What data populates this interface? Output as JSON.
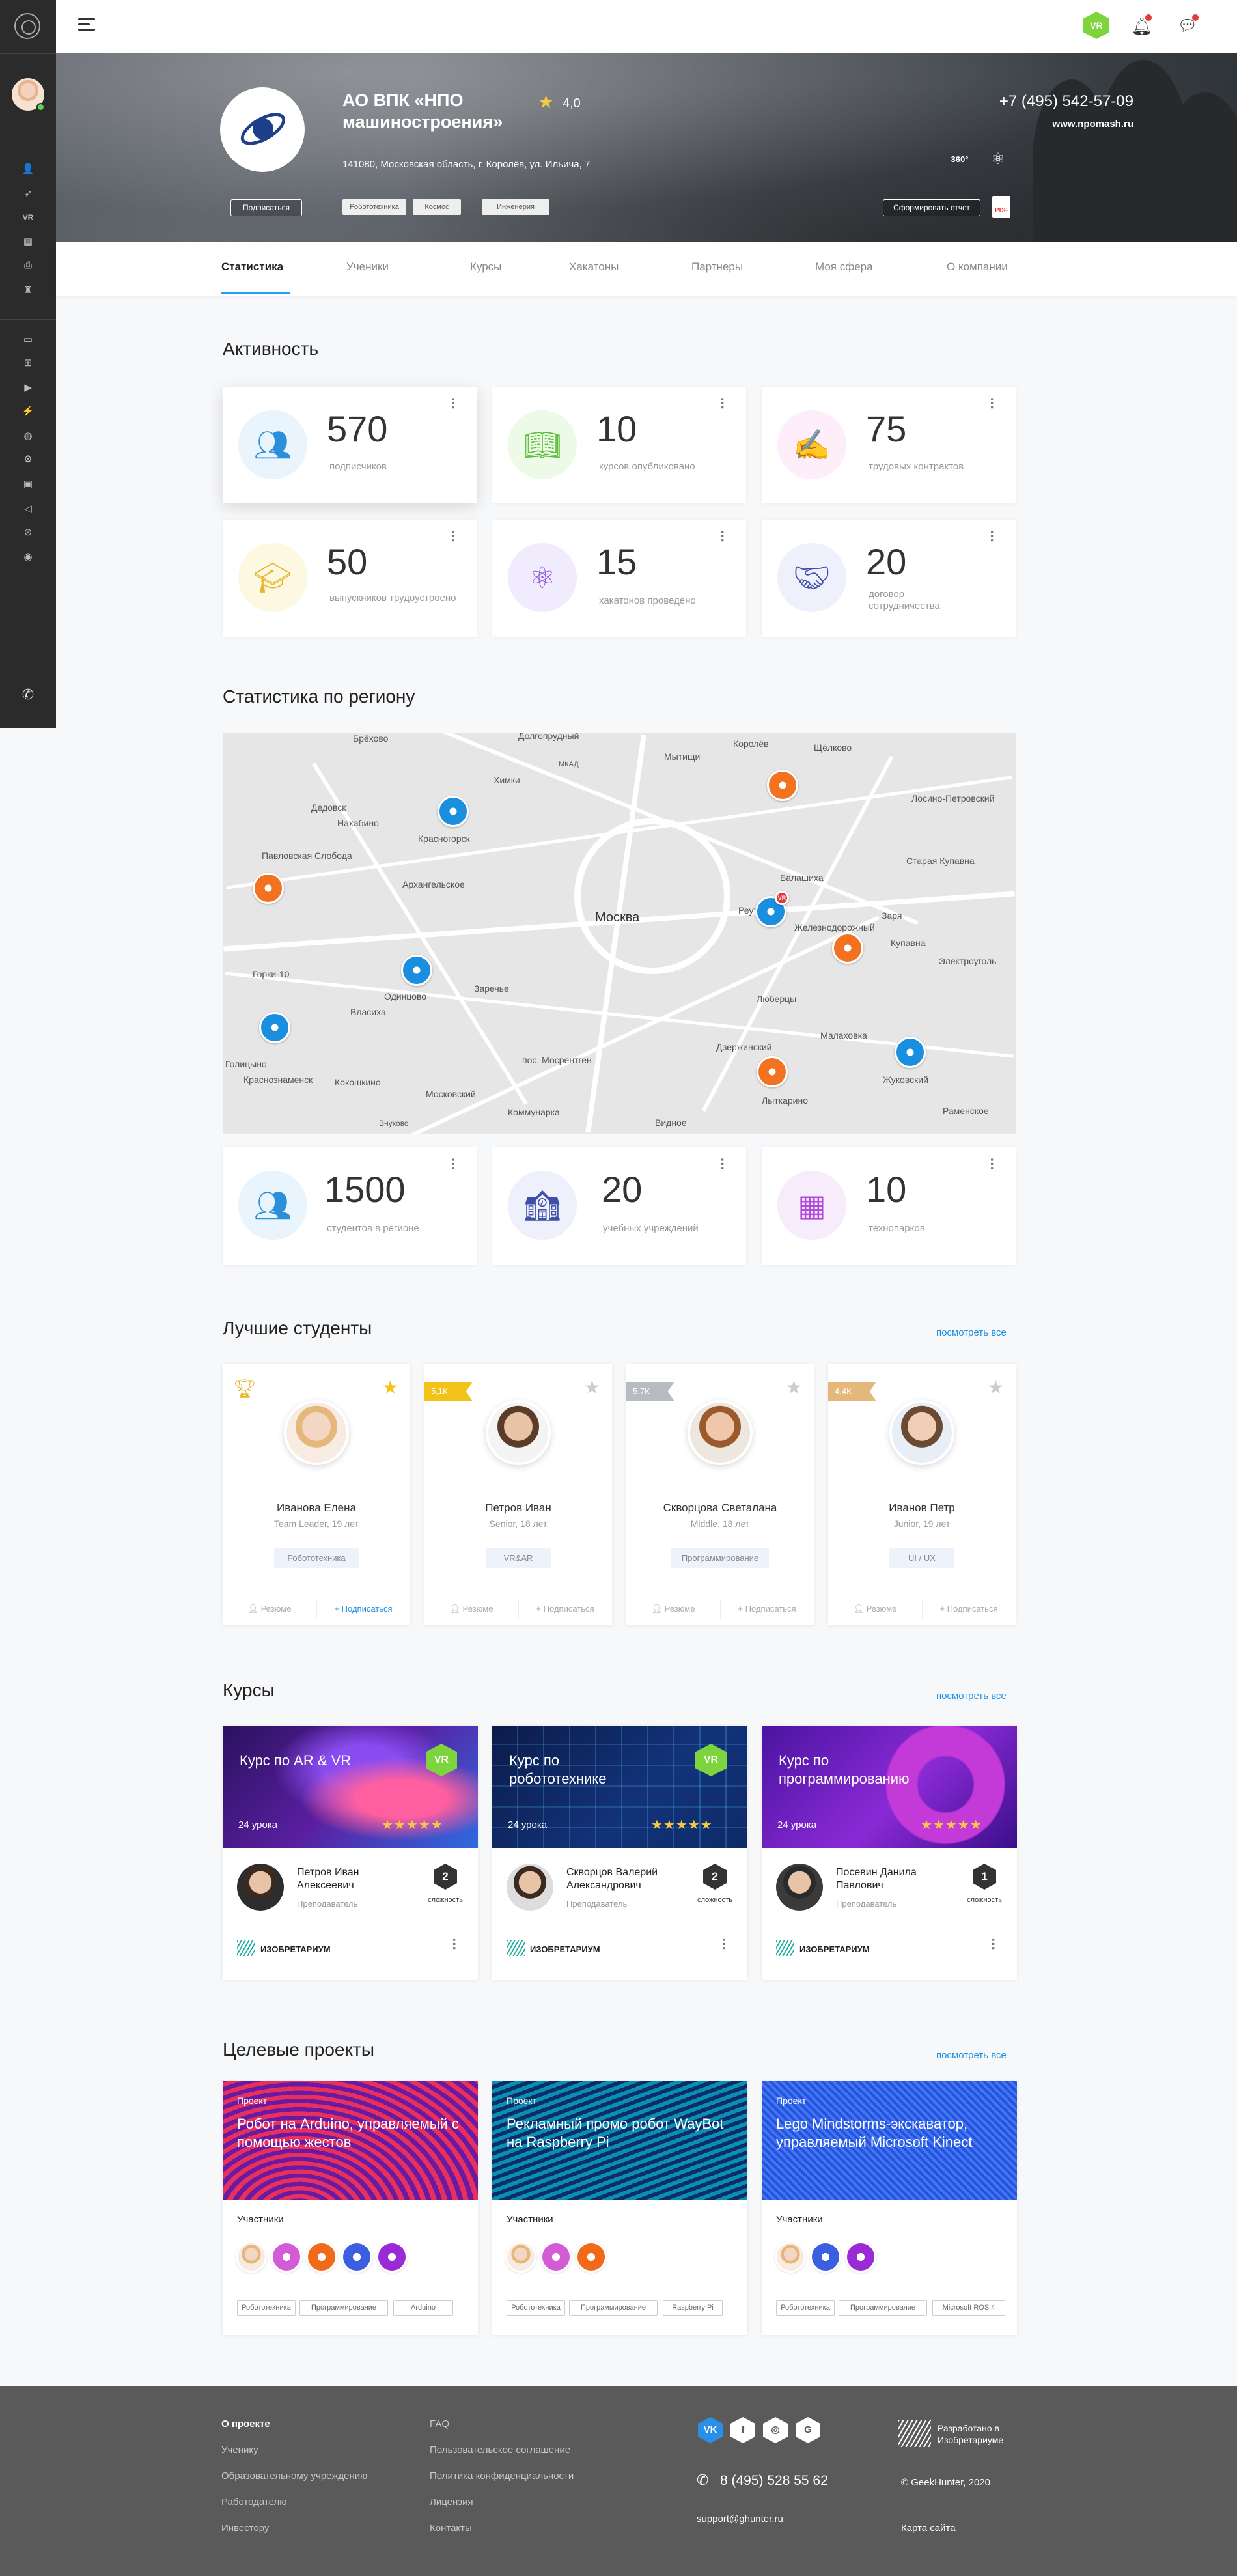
{
  "company": {
    "name": "АО ВПК «НПО машиностроения»",
    "rating": "4,0",
    "address": "141080, Московская область, г. Королёв, ул. Ильича, 7",
    "phone": "+7 (495) 542-57-09",
    "site": "www.npomash.ru",
    "subscribe_label": "Подписаться",
    "tags": [
      "Робототехника",
      "Космос",
      "Инженерия"
    ],
    "report_label": "Сформировать отчет",
    "icon_360": "360°",
    "pdf_label": "PDF"
  },
  "topbar": {
    "vr_label": "VR"
  },
  "tabs": [
    "Статистика",
    "Ученики",
    "Курсы",
    "Хакатоны",
    "Партнеры",
    "Моя сфера",
    "О компании"
  ],
  "activity": {
    "title": "Активность",
    "cards": [
      {
        "value": "570",
        "label": "подписчиков",
        "icon": "students-icon",
        "color": "#eaf4fc"
      },
      {
        "value": "10",
        "label": "курсов опубликовано",
        "icon": "book-icon",
        "color": "#eefae8"
      },
      {
        "value": "75",
        "label": "трудовых контрактов",
        "icon": "contract-icon",
        "color": "#fdeefa"
      },
      {
        "value": "50",
        "label": "выпускников трудоустроено",
        "icon": "graduate-icon",
        "color": "#fdf8e2"
      },
      {
        "value": "15",
        "label": "хакатонов проведено",
        "icon": "atom-icon",
        "color": "#f1ecfd"
      },
      {
        "value": "20",
        "label": "договор сотрудничества",
        "icon": "handshake-icon",
        "color": "#eef0fc"
      }
    ]
  },
  "region": {
    "title": "Статистика по региону",
    "map_labels": [
      "Долгопрудный",
      "Королёв",
      "Мытищи",
      "Щёлково",
      "Химки",
      "Лосино-Петровский",
      "Красногорск",
      "Балашиха",
      "Старая Купавна",
      "Москва",
      "Реутов",
      "Железнодорожный",
      "Купавна",
      "Одинцово",
      "Люберцы",
      "Электроуголь",
      "Дзержинский",
      "Малаховка",
      "Жуковский",
      "Раменское",
      "Лыткарино",
      "Видное",
      "Московский",
      "Коммунарка",
      "пос. Мосрентген",
      "Голицыно",
      "Краснознаменск",
      "Кокошкино",
      "Брёхово",
      "Дедовск",
      "Нахабино",
      "Павловская Слобода",
      "Архангельское",
      "Заречье",
      "Власиха",
      "Горки-10",
      "Заря",
      "МКАД",
      "Внуково"
    ],
    "cards": [
      {
        "value": "1500",
        "label": "студентов в регионе",
        "icon": "students-icon",
        "color": "#eaf4fc"
      },
      {
        "value": "20",
        "label": "учебных учреждений",
        "icon": "school-icon",
        "color": "#eef0fc"
      },
      {
        "value": "10",
        "label": "технопарков",
        "icon": "chip-icon",
        "color": "#f6ecfc"
      }
    ]
  },
  "students": {
    "title": "Лучшие студенты",
    "see_all": "посмотреть все",
    "resume_label": "Резюме",
    "subscribe_label": "Подписаться",
    "items": [
      {
        "name": "Иванова Елена",
        "sub": "Team Leader, 19 лет",
        "skill": "Робототехника",
        "rank": "",
        "fav": true
      },
      {
        "name": "Петров Иван",
        "sub": "Senior, 18 лет",
        "skill": "VR&AR",
        "rank": "5,1К",
        "fav": false
      },
      {
        "name": "Скворцова Светалана",
        "sub": "Middle, 18 лет",
        "skill": "Программирование",
        "rank": "5,7К",
        "fav": false
      },
      {
        "name": "Иванов Петр",
        "sub": "Junior, 19 лет",
        "skill": "UI / UX",
        "rank": "4,4К",
        "fav": false
      }
    ]
  },
  "courses": {
    "title": "Курсы",
    "see_all": "посмотреть все",
    "brand": "ИЗОБРЕТАРИУМ",
    "difficulty_label": "сложность",
    "teacher_role": "Преподаватель",
    "items": [
      {
        "title": "Курс по AR & VR",
        "lessons": "24 урока",
        "stars": "★★★★★",
        "teacher": "Петров Иван Алексеевич",
        "difficulty": "2",
        "vr": "VR"
      },
      {
        "title": "Курс по робототехнике",
        "lessons": "24 урока",
        "stars": "★★★★★",
        "teacher": "Скворцов Валерий Александрович",
        "difficulty": "2",
        "vr": "VR"
      },
      {
        "title": "Курс по программированию",
        "lessons": "24 урока",
        "stars": "★★★★★",
        "teacher": "Посевин Данила Павлович",
        "difficulty": "1",
        "vr": ""
      }
    ]
  },
  "projects": {
    "title": "Целевые проекты",
    "see_all": "посмотреть все",
    "project_label": "Проект",
    "members_label": "Участники",
    "items": [
      {
        "title": "Робот на Arduino, управляемый с помощью жестов",
        "tags": [
          "Робототехника",
          "Программирование",
          "Arduino"
        ]
      },
      {
        "title": "Рекламный промо робот WayBot на Raspberry Pi",
        "tags": [
          "Робототехника",
          "Программирование",
          "Raspberry Pi"
        ]
      },
      {
        "title": "Lego Mindstorms-экскаватор, управляемый Microsoft Kinect",
        "tags": [
          "Робототехника",
          "Программирование",
          "Microsoft ROS 4"
        ]
      }
    ]
  },
  "footer": {
    "col1": [
      "О проекте",
      "Ученику",
      "Образовательному учреждению",
      "Работодателю",
      "Инвестору"
    ],
    "col2": [
      "FAQ",
      "Пользовательское соглашение",
      "Политика конфиденциальности",
      "Лицензия",
      "Контакты"
    ],
    "social": [
      "VK",
      "f",
      "◎",
      "G"
    ],
    "phone": "8 (495) 528 55 62",
    "email": "support@ghunter.ru",
    "developed": "Разработано в Изобретариуме",
    "copyright": "© GeekHunter, 2020",
    "sitemap": "Карта сайта"
  }
}
